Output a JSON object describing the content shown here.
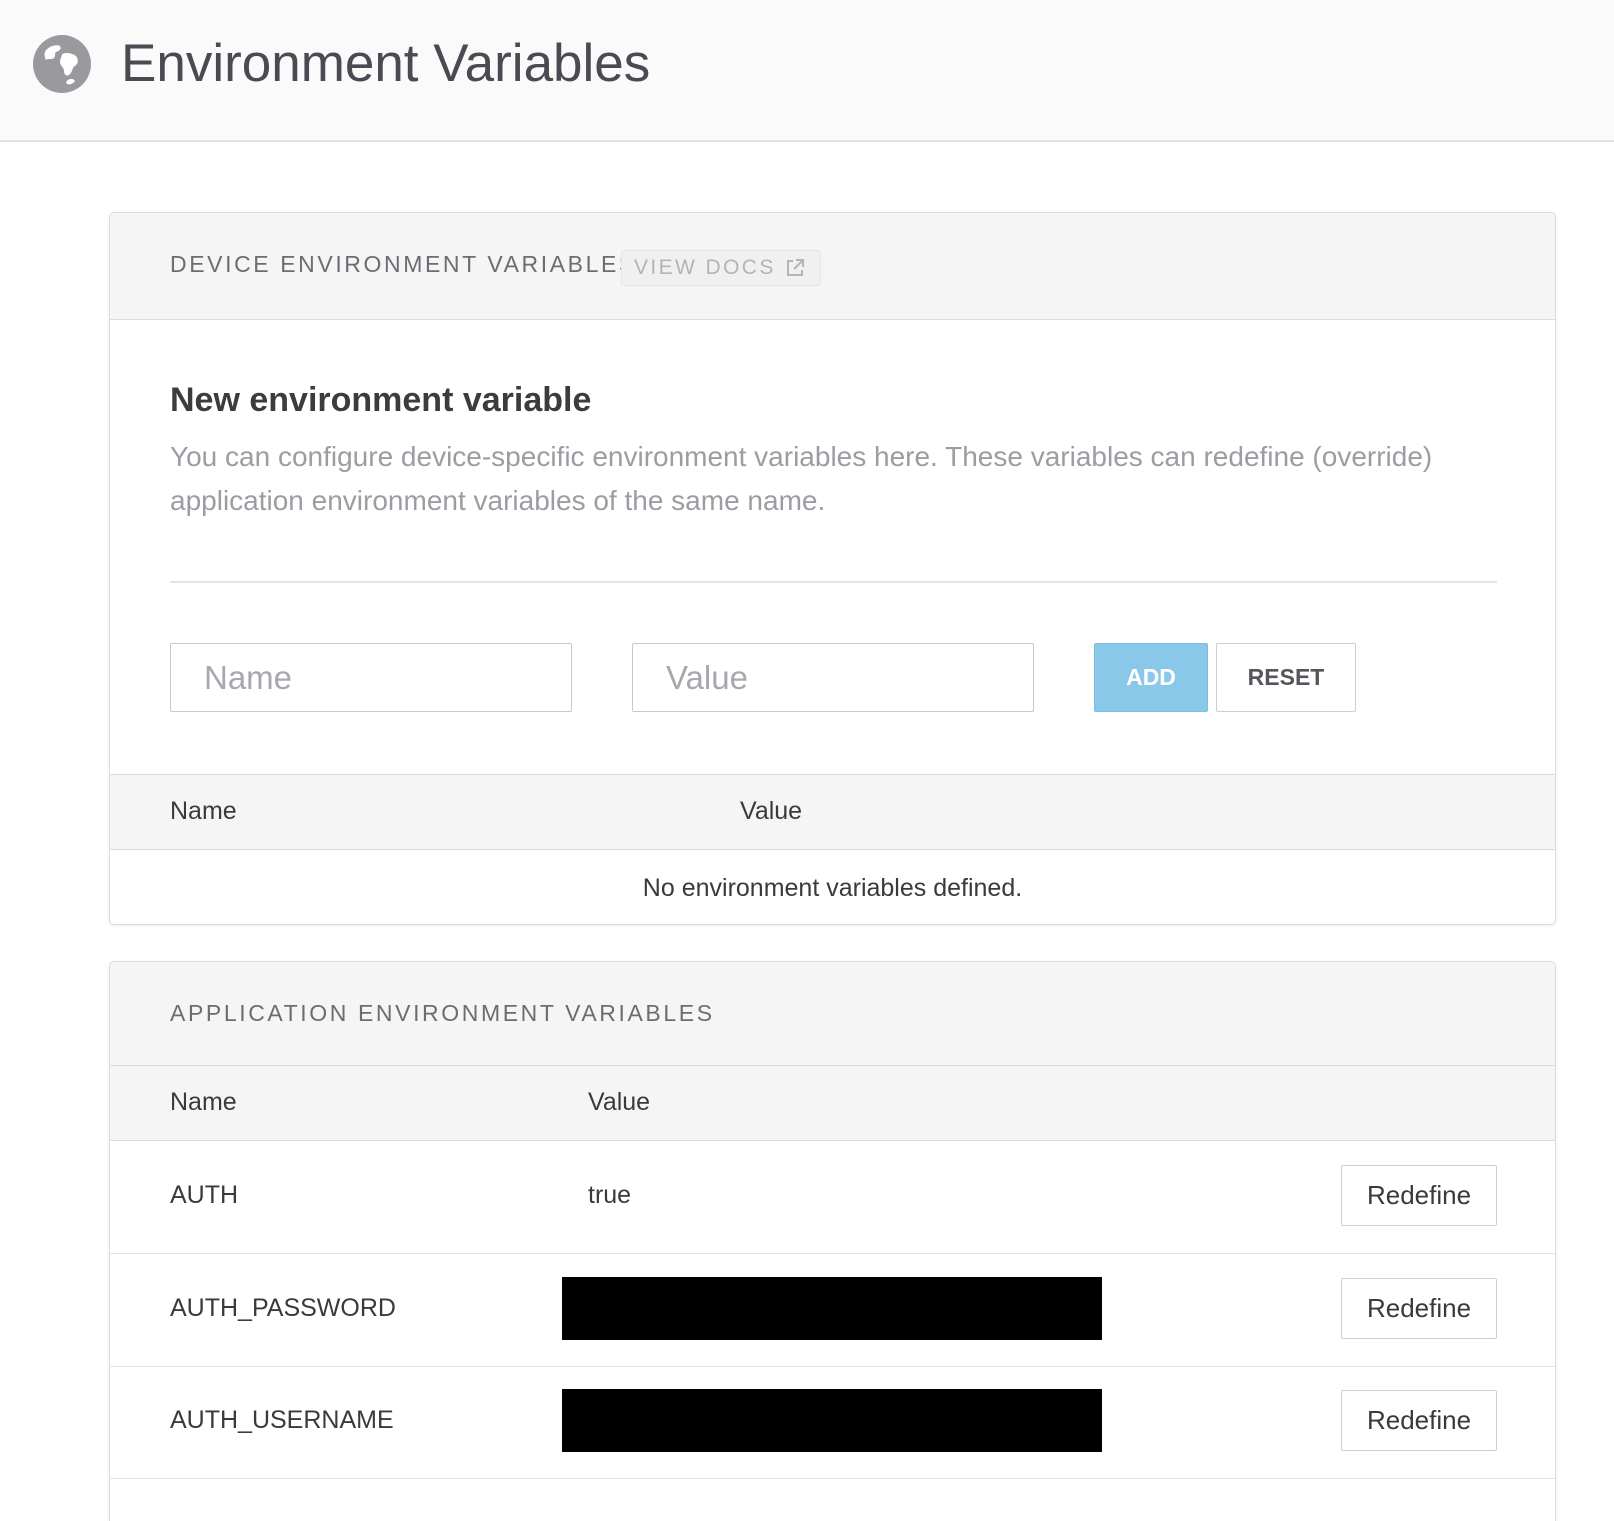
{
  "header": {
    "title": "Environment Variables",
    "icon": "globe-icon"
  },
  "colors": {
    "accent": "#8ac8ea",
    "header_bg": "#fafafa",
    "panel_head_bg": "#f5f5f5",
    "redacted": "#000000"
  },
  "device_panel": {
    "heading": "DEVICE ENVIRONMENT VARIABLES",
    "docs_label": "VIEW DOCS",
    "docs_icon": "external-link-icon",
    "form_title": "New environment variable",
    "form_description": "You can configure device-specific environment variables here. These variables can redefine (override) application environment variables of the same name.",
    "name_placeholder": "Name",
    "value_placeholder": "Value",
    "add_label": "ADD",
    "reset_label": "RESET",
    "columns": {
      "name": "Name",
      "value": "Value"
    },
    "empty_message": "No environment variables defined."
  },
  "app_panel": {
    "heading": "APPLICATION ENVIRONMENT VARIABLES",
    "columns": {
      "name": "Name",
      "value": "Value"
    },
    "rows": [
      {
        "name": "AUTH",
        "value": "true",
        "redacted": false,
        "action": "Redefine"
      },
      {
        "name": "AUTH_PASSWORD",
        "value": "",
        "redacted": true,
        "action": "Redefine"
      },
      {
        "name": "AUTH_USERNAME",
        "value": "",
        "redacted": true,
        "action": "Redefine"
      }
    ]
  }
}
